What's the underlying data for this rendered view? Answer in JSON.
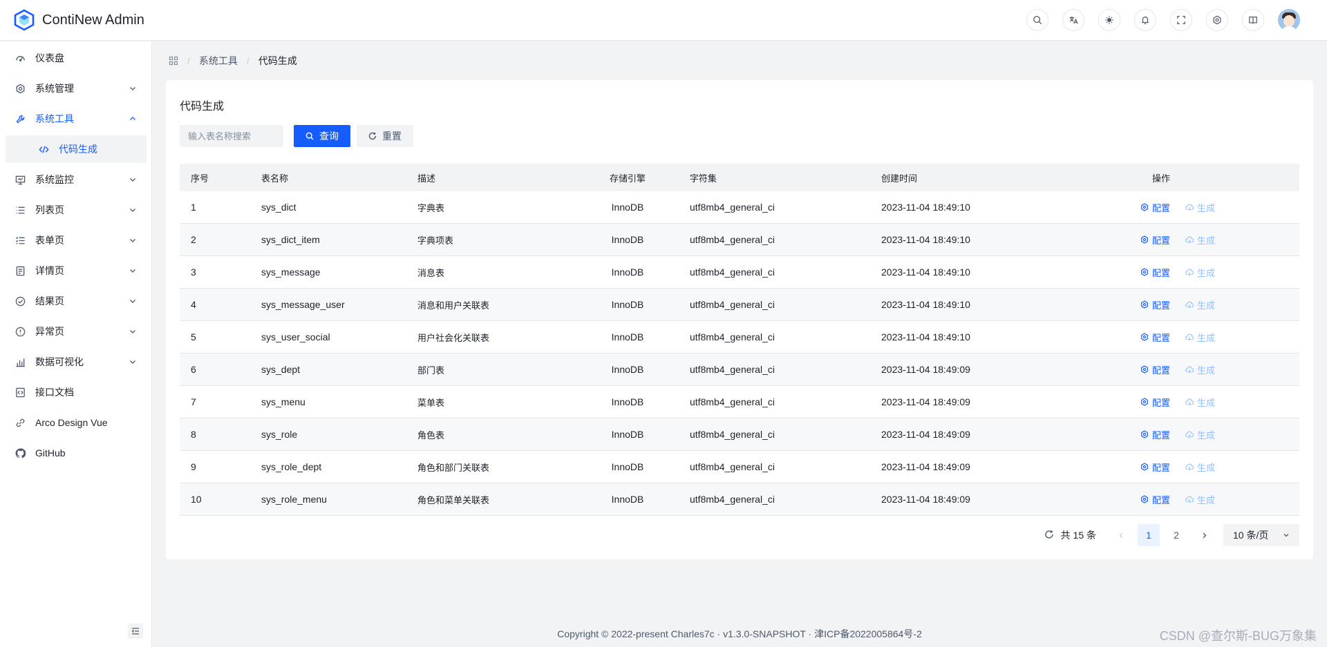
{
  "app": {
    "title": "ContiNew Admin"
  },
  "header": {
    "icons": [
      "search-icon",
      "translate-icon",
      "theme-icon",
      "bell-icon",
      "fullscreen-icon",
      "settings-icon",
      "book-icon"
    ]
  },
  "sidebar": {
    "items": [
      {
        "label": "仪表盘",
        "icon": "dashboard-icon"
      },
      {
        "label": "系统管理",
        "icon": "gear-icon"
      },
      {
        "label": "系统工具",
        "icon": "tool-icon"
      },
      {
        "label": "代码生成",
        "icon": "code-icon"
      },
      {
        "label": "系统监控",
        "icon": "monitor-icon"
      },
      {
        "label": "列表页",
        "icon": "list-icon"
      },
      {
        "label": "表单页",
        "icon": "form-icon"
      },
      {
        "label": "详情页",
        "icon": "file-icon"
      },
      {
        "label": "结果页",
        "icon": "check-circle-icon"
      },
      {
        "label": "异常页",
        "icon": "exclamation-icon"
      },
      {
        "label": "数据可视化",
        "icon": "bar-chart-icon"
      },
      {
        "label": "接口文档",
        "icon": "api-doc-icon"
      },
      {
        "label": "Arco Design Vue",
        "icon": "link-icon"
      },
      {
        "label": "GitHub",
        "icon": "github-icon"
      }
    ]
  },
  "breadcrumb": {
    "items": [
      "系统工具",
      "代码生成"
    ]
  },
  "main": {
    "title": "代码生成",
    "search": {
      "placeholder": "输入表名称搜索",
      "value": ""
    },
    "query_label": "查询",
    "reset_label": "重置"
  },
  "table": {
    "columns": [
      "序号",
      "表名称",
      "描述",
      "存储引擎",
      "字符集",
      "创建时间",
      "操作"
    ],
    "rows": [
      {
        "idx": "1",
        "name": "sys_dict",
        "desc": "字典表",
        "engine": "InnoDB",
        "charset": "utf8mb4_general_ci",
        "created": "2023-11-04 18:49:10"
      },
      {
        "idx": "2",
        "name": "sys_dict_item",
        "desc": "字典项表",
        "engine": "InnoDB",
        "charset": "utf8mb4_general_ci",
        "created": "2023-11-04 18:49:10"
      },
      {
        "idx": "3",
        "name": "sys_message",
        "desc": "消息表",
        "engine": "InnoDB",
        "charset": "utf8mb4_general_ci",
        "created": "2023-11-04 18:49:10"
      },
      {
        "idx": "4",
        "name": "sys_message_user",
        "desc": "消息和用户关联表",
        "engine": "InnoDB",
        "charset": "utf8mb4_general_ci",
        "created": "2023-11-04 18:49:10"
      },
      {
        "idx": "5",
        "name": "sys_user_social",
        "desc": "用户社会化关联表",
        "engine": "InnoDB",
        "charset": "utf8mb4_general_ci",
        "created": "2023-11-04 18:49:10"
      },
      {
        "idx": "6",
        "name": "sys_dept",
        "desc": "部门表",
        "engine": "InnoDB",
        "charset": "utf8mb4_general_ci",
        "created": "2023-11-04 18:49:09"
      },
      {
        "idx": "7",
        "name": "sys_menu",
        "desc": "菜单表",
        "engine": "InnoDB",
        "charset": "utf8mb4_general_ci",
        "created": "2023-11-04 18:49:09"
      },
      {
        "idx": "8",
        "name": "sys_role",
        "desc": "角色表",
        "engine": "InnoDB",
        "charset": "utf8mb4_general_ci",
        "created": "2023-11-04 18:49:09"
      },
      {
        "idx": "9",
        "name": "sys_role_dept",
        "desc": "角色和部门关联表",
        "engine": "InnoDB",
        "charset": "utf8mb4_general_ci",
        "created": "2023-11-04 18:49:09"
      },
      {
        "idx": "10",
        "name": "sys_role_menu",
        "desc": "角色和菜单关联表",
        "engine": "InnoDB",
        "charset": "utf8mb4_general_ci",
        "created": "2023-11-04 18:49:09"
      }
    ],
    "actions": {
      "config": "配置",
      "generate": "生成"
    }
  },
  "pagination": {
    "total": "共 15 条",
    "pages": [
      "1",
      "2"
    ],
    "current": "1",
    "page_size": "10 条/页"
  },
  "footer": {
    "text": "Copyright © 2022-present Charles7c · v1.3.0-SNAPSHOT · 津ICP备2022005864号-2"
  },
  "watermark": "CSDN @查尔斯-BUG万象集",
  "colors": {
    "primary": "#165dff",
    "primary_light": "#94bfff",
    "bg": "#f2f3f5"
  }
}
